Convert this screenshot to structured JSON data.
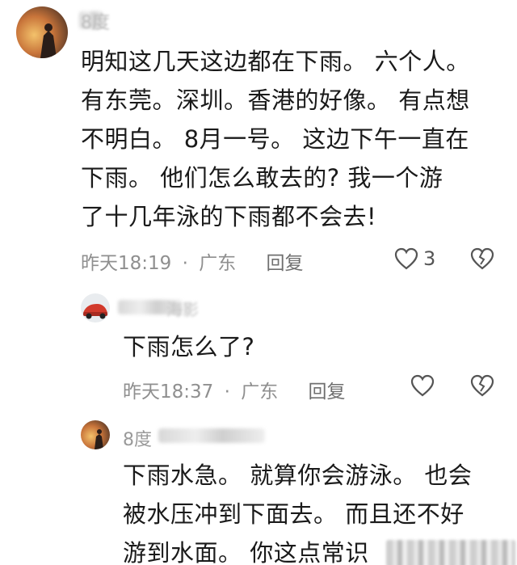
{
  "comments": [
    {
      "username": "8度",
      "lines": [
        "明知这几天这边都在下雨。 六个人。",
        "有东莞。深圳。香港的好像。 有点想",
        "不明白。 8月一号。 这边下午一直在",
        "下雨。 他们怎么敢去的? 我一个游",
        "了十几年泳的下雨都不会去!"
      ],
      "time": "昨天18:19",
      "separator": "·",
      "location": "广东",
      "reply_label": "回复",
      "likes": "3"
    },
    {
      "username": "海影",
      "lines": [
        "下雨怎么了?"
      ],
      "time": "昨天18:37",
      "separator": "·",
      "location": "广东",
      "reply_label": "回复",
      "likes": ""
    },
    {
      "username": "8度",
      "lines": [
        "下雨水急。 就算你会游泳。 也会",
        "被水压冲到下面去。 而且还不好",
        "游到水面。 你这点常识"
      ]
    }
  ],
  "icons": {
    "like": "heart-outline-icon",
    "dislike": "broken-heart-icon"
  }
}
